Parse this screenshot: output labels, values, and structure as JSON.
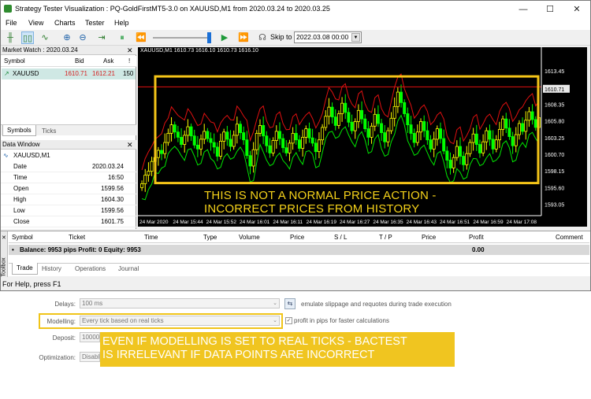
{
  "window": {
    "title": "Strategy Tester Visualization : PQ-GoldFirstMT5-3.0 on XAUUSD,M1 from 2020.03.24 to 2020.03.25"
  },
  "menu": [
    "File",
    "View",
    "Charts",
    "Tester",
    "Help"
  ],
  "toolbar": {
    "skip_label": "Skip to",
    "skip_date": "2022.03.08 00:00"
  },
  "market_watch": {
    "title": "Market Watch : 2020.03.24",
    "headers": [
      "Symbol",
      "Bid",
      "Ask",
      "!"
    ],
    "row": {
      "symbol": "XAUUSD",
      "bid": "1610.71",
      "ask": "1612.21",
      "spread": "150"
    },
    "tabs": [
      "Symbols",
      "Ticks"
    ]
  },
  "data_window": {
    "title": "Data Window",
    "symbol": "XAUUSD,M1",
    "rows": [
      {
        "k": "Date",
        "v": "2020.03.24"
      },
      {
        "k": "Time",
        "v": "16:50"
      },
      {
        "k": "Open",
        "v": "1599.56"
      },
      {
        "k": "High",
        "v": "1604.30"
      },
      {
        "k": "Low",
        "v": "1599.56"
      },
      {
        "k": "Close",
        "v": "1601.75"
      }
    ]
  },
  "chart": {
    "header": "XAUUSD,M1  1610.73  1616.10  1610.73  1616.10",
    "price_labels": [
      "1613.45",
      "1610.71",
      "1608.35",
      "1605.80",
      "1603.25",
      "1600.70",
      "1598.15",
      "1595.60",
      "1593.05"
    ],
    "time_labels": [
      "24 Mar 2020",
      "24 Mar 15:44",
      "24 Mar 15:52",
      "24 Mar 16:01",
      "24 Mar 16:11",
      "24 Mar 16:19",
      "24 Mar 16:27",
      "24 Mar 16:35",
      "24 Mar 16:43",
      "24 Mar 16:51",
      "24 Mar 16:59",
      "24 Mar 17:08"
    ],
    "annotation_line1": "THIS IS NOT A NORMAL PRICE ACTION -",
    "annotation_line2": "INCORRECT PRICES FROM HISTORY",
    "colors": {
      "up": "#ffff00",
      "down": "#00ff00",
      "band": "#e01010",
      "highlight": "#f5c518"
    }
  },
  "chart_data": {
    "type": "candlestick",
    "ylim": [
      1591.8,
      1616.1
    ],
    "close": [
      1596.2,
      1597.5,
      1598.1,
      1599.6,
      1600.2,
      1601.3,
      1600.8,
      1602.5,
      1603.9,
      1605.2,
      1604.1,
      1603.3,
      1602.2,
      1603.6,
      1604.9,
      1603.5,
      1602.1,
      1601.5,
      1603.0,
      1604.2,
      1603.1,
      1602.5,
      1601.8,
      1600.4,
      1602.7,
      1604.1,
      1603.0,
      1601.9,
      1603.6,
      1605.3,
      1604.0,
      1602.9,
      1600.5,
      1598.9,
      1601.4,
      1603.9,
      1605.1,
      1603.5,
      1602.0,
      1600.9,
      1602.8,
      1604.2,
      1603.1,
      1601.7,
      1600.9,
      1602.4,
      1603.9,
      1602.9,
      1601.6,
      1603.3,
      1604.6,
      1603.2,
      1602.4,
      1601.1,
      1602.9,
      1604.8,
      1606.5,
      1607.9,
      1606.4,
      1605.1,
      1606.9,
      1608.5,
      1607.1,
      1605.6,
      1604.3,
      1605.7,
      1607.4,
      1606.1,
      1604.6,
      1603.3,
      1605.0,
      1606.8,
      1605.4,
      1604.0,
      1602.6,
      1604.3,
      1606.2,
      1608.0,
      1610.2,
      1608.6,
      1606.9,
      1605.2,
      1603.9,
      1602.5,
      1604.1,
      1605.7,
      1604.3,
      1602.9,
      1601.5,
      1603.0,
      1604.6,
      1603.1,
      1601.2,
      1599.8,
      1598.6,
      1600.2,
      1601.9,
      1600.4,
      1599.1,
      1600.8,
      1602.5,
      1603.8,
      1602.2,
      1600.9,
      1602.6,
      1604.3,
      1603.0,
      1601.5,
      1602.9,
      1604.5,
      1606.1,
      1604.7,
      1603.4,
      1602.0,
      1603.7,
      1605.4,
      1604.2,
      1605.9,
      1607.2,
      1606.0,
      1604.8,
      1606.3
    ]
  },
  "terminal": {
    "headers": [
      "Symbol",
      "Ticket",
      "Time",
      "Type",
      "Volume",
      "Price",
      "S / L",
      "T / P",
      "Price",
      "Profit",
      "Comment"
    ],
    "balance_text": "Balance: 9953 pips   Profit: 0   Equity: 9953",
    "profit_value": "0.00",
    "tabs": [
      "Trade",
      "History",
      "Operations",
      "Journal"
    ],
    "side_label": "Toolbox"
  },
  "status": {
    "text": "For Help, press F1"
  },
  "settings": {
    "delays_label": "Delays:",
    "delays_value": "100 ms",
    "emulate_text": "emulate slippage and requotes during trade execution",
    "modelling_label": "Modelling:",
    "modelling_value": "Every tick based on real ticks",
    "profit_pips_text": "profit in pips for faster calculations",
    "deposit_label": "Deposit:",
    "deposit_value": "10000",
    "optimization_label": "Optimization:",
    "optimization_value": "Disable",
    "note_line1": "EVEN IF MODELLING IS SET TO REAL TICKS - BACTEST",
    "note_line2": "IS IRRELEVANT IF DATA POINTS ARE INCORRECT"
  }
}
